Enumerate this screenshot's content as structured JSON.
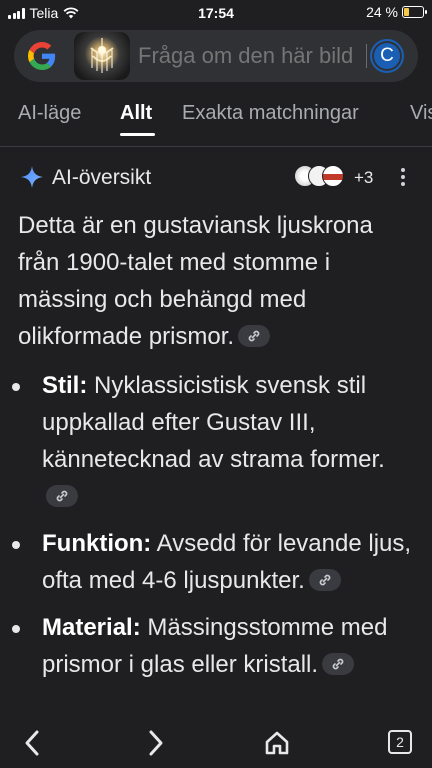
{
  "status_bar": {
    "carrier": "Telia",
    "time": "17:54",
    "battery": "24 %"
  },
  "search": {
    "placeholder": "Fråga om den här bild",
    "avatar_initial": "C"
  },
  "tabs": [
    {
      "label": "AI-läge"
    },
    {
      "label": "Allt",
      "active": true
    },
    {
      "label": "Exakta matchningar"
    },
    {
      "label": "Visuellt"
    }
  ],
  "ai_overview": {
    "title": "AI-översikt",
    "source_count": "+3",
    "intro": "Detta är en gustaviansk ljuskrona från 1900-talet med stomme i mässing och behängd med olikformade prismor.",
    "bullets": [
      {
        "term": "Stil:",
        "text": " Nyklassicistisk svensk stil uppkallad efter Gustav III, kännetecknad av strama former."
      },
      {
        "term": "Funktion:",
        "text": " Avsedd för levande ljus, ofta med 4-6 ljuspunkter."
      },
      {
        "term": "Material:",
        "text": " Mässingsstomme med prismor i glas eller kristall."
      }
    ]
  },
  "bottom_nav": {
    "tab_count": "2"
  },
  "colors": {
    "background": "#1f1f21",
    "search_bg": "#303134",
    "avatar": "#1a5fb4",
    "battery_low": "#f6c94a",
    "spark": "#4c8df6"
  }
}
